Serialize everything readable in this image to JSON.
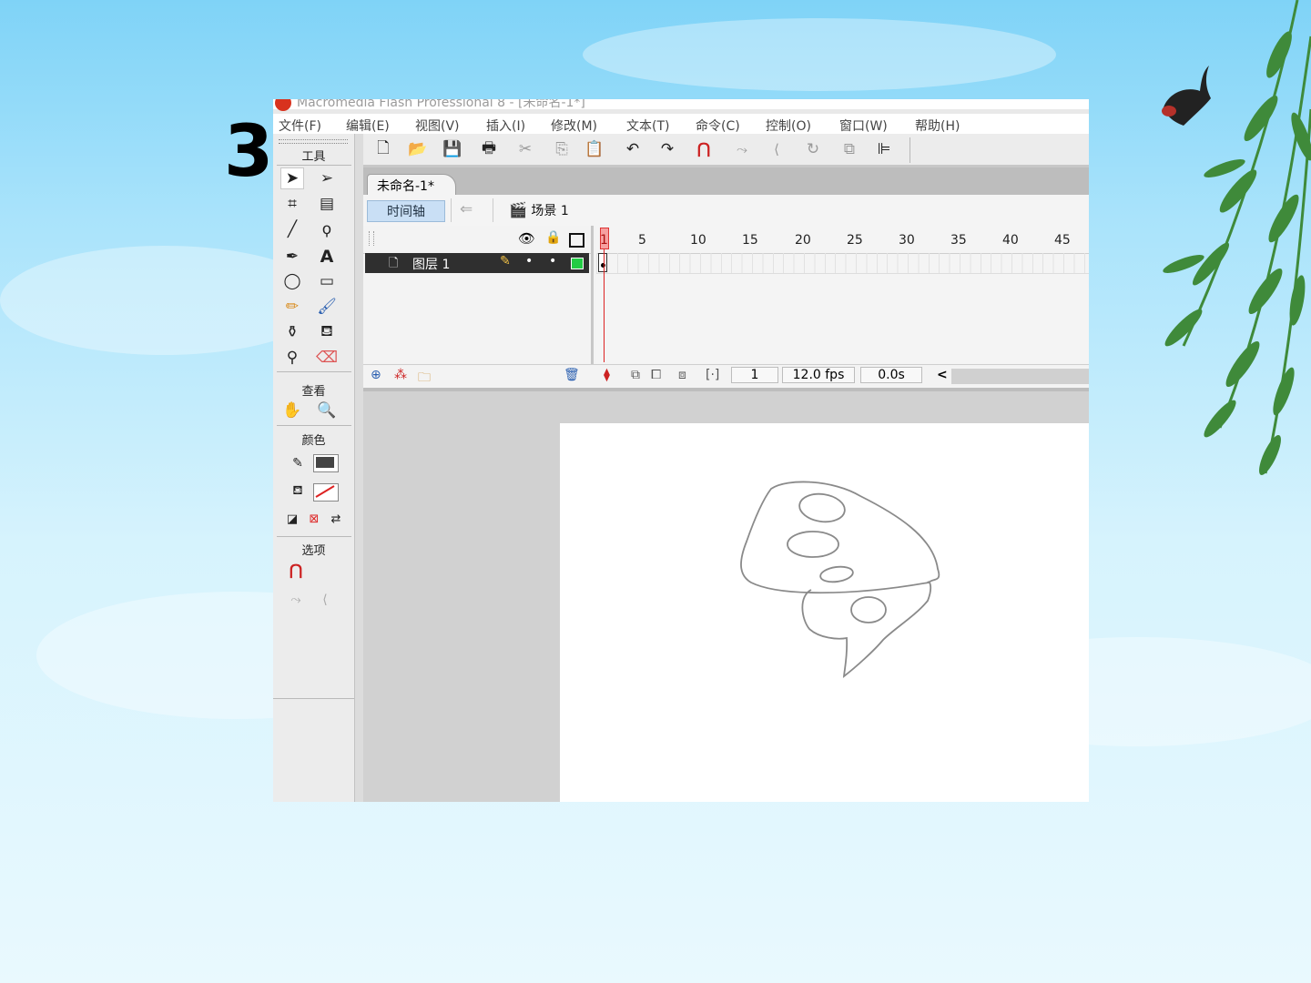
{
  "slide": {
    "number": "3"
  },
  "window": {
    "title": "Macromedia Flash Professional 8 - [未命名-1*]",
    "menu": [
      "文件(F)",
      "编辑(E)",
      "视图(V)",
      "插入(I)",
      "修改(M)",
      "文本(T)",
      "命令(C)",
      "控制(O)",
      "窗口(W)",
      "帮助(H)"
    ]
  },
  "tools_panel": {
    "tools_header": "工具",
    "view_header": "查看",
    "colors_header": "颜色",
    "options_header": "选项"
  },
  "document": {
    "tab_label": "未命名-1*",
    "timeline_button": "时间轴",
    "scene_label": "场景 1"
  },
  "timeline": {
    "ruler_numbers": [
      "1",
      "5",
      "10",
      "15",
      "20",
      "25",
      "30",
      "35",
      "40",
      "45"
    ],
    "layer_name": "图层 1",
    "current_frame": "1",
    "frame_rate": "12.0 fps",
    "elapsed_time": "0.0s",
    "scroll_left": "<"
  },
  "colors": {
    "accent": "#c9dff5",
    "stroke_swatch": "#444444",
    "layer_outline": "#22cc44"
  }
}
